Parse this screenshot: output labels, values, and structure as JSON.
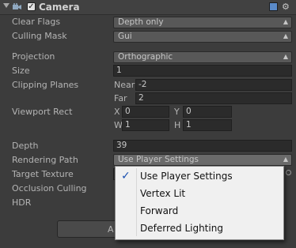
{
  "component": {
    "title": "Camera",
    "enabled": true
  },
  "fields": {
    "clear_flags": {
      "label": "Clear Flags",
      "value": "Depth only"
    },
    "culling_mask": {
      "label": "Culling Mask",
      "value": "Gui"
    },
    "projection": {
      "label": "Projection",
      "value": "Orthographic"
    },
    "size": {
      "label": "Size",
      "value": "1"
    },
    "clipping_planes": {
      "label": "Clipping Planes",
      "near_label": "Near",
      "near": "-2",
      "far_label": "Far",
      "far": "2"
    },
    "viewport_rect": {
      "label": "Viewport Rect",
      "x_label": "X",
      "x": "0",
      "y_label": "Y",
      "y": "0",
      "w_label": "W",
      "w": "1",
      "h_label": "H",
      "h": "1"
    },
    "depth": {
      "label": "Depth",
      "value": "39"
    },
    "rendering_path": {
      "label": "Rendering Path",
      "value": "Use Player Settings"
    },
    "target_texture": {
      "label": "Target Texture"
    },
    "occlusion_culling": {
      "label": "Occlusion Culling"
    },
    "hdr": {
      "label": "HDR"
    }
  },
  "popup": {
    "items": [
      {
        "label": "Use Player Settings",
        "selected": true
      },
      {
        "label": "Vertex Lit",
        "selected": false
      },
      {
        "label": "Forward",
        "selected": false
      },
      {
        "label": "Deferred Lighting",
        "selected": false
      }
    ]
  },
  "button": {
    "label": "A"
  }
}
